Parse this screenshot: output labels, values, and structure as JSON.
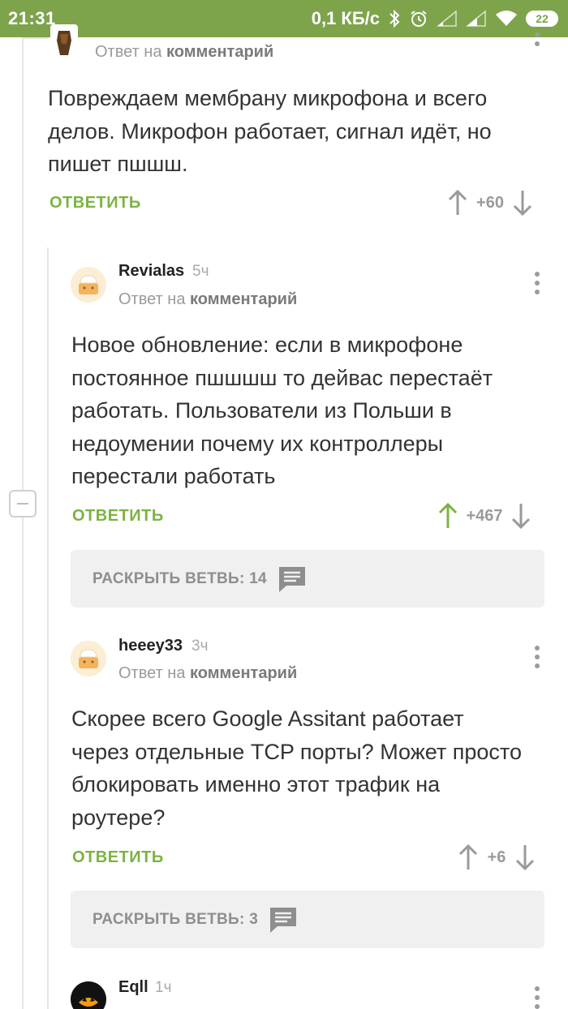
{
  "status_bar": {
    "time": "21:31",
    "net_speed": "0,1 КБ/с",
    "battery": "22",
    "accent": "#7da44b"
  },
  "labels": {
    "reply_to_prefix": "Ответ на",
    "reply_to_link": "комментарий",
    "reply_button": "ОТВЕТИТЬ",
    "expand_prefix": "РАСКРЫТЬ ВЕТВЬ:"
  },
  "comments": [
    {
      "body": "Повреждаем мембрану микрофона и всего делов. Микрофон работает, сигнал идёт, но пишет пшшш.",
      "score": "+60",
      "upvoted": false
    },
    {
      "username": "Revialas",
      "ago": "5ч",
      "body": "Новое обновление: если в микрофоне постоянное пшшшш то дейвас перестаёт работать. Пользователи из Польши в недоумении почему их контроллеры перестали работать",
      "score": "+467",
      "upvoted": true,
      "branch_count": "14"
    },
    {
      "username": "heeey33",
      "ago": "3ч",
      "body": "Скорее всего Google Assitant работает через отдельные TCP порты? Может просто блокировать именно этот трафик на роутере?",
      "score": "+6",
      "upvoted": false,
      "branch_count": "3"
    },
    {
      "username": "Eqll",
      "ago": "1ч"
    }
  ],
  "colors": {
    "reply_green": "#7cb342",
    "upvote_active": "#7cb342",
    "vote_inactive": "#9a9a9a"
  }
}
